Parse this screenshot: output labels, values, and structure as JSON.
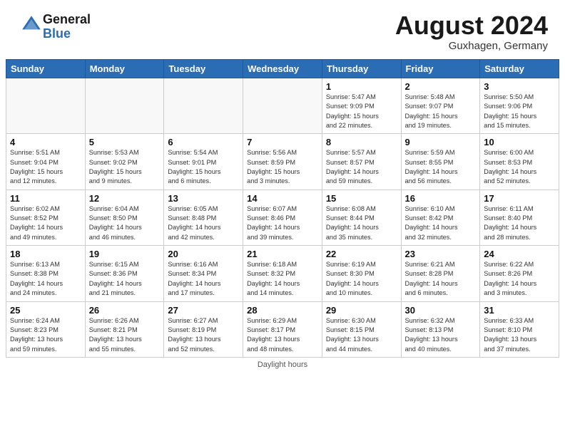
{
  "header": {
    "logo_general": "General",
    "logo_blue": "Blue",
    "month_title": "August 2024",
    "location": "Guxhagen, Germany"
  },
  "days_of_week": [
    "Sunday",
    "Monday",
    "Tuesday",
    "Wednesday",
    "Thursday",
    "Friday",
    "Saturday"
  ],
  "footer": {
    "note": "Daylight hours"
  },
  "weeks": [
    [
      {
        "day": "",
        "info": ""
      },
      {
        "day": "",
        "info": ""
      },
      {
        "day": "",
        "info": ""
      },
      {
        "day": "",
        "info": ""
      },
      {
        "day": "1",
        "info": "Sunrise: 5:47 AM\nSunset: 9:09 PM\nDaylight: 15 hours\nand 22 minutes."
      },
      {
        "day": "2",
        "info": "Sunrise: 5:48 AM\nSunset: 9:07 PM\nDaylight: 15 hours\nand 19 minutes."
      },
      {
        "day": "3",
        "info": "Sunrise: 5:50 AM\nSunset: 9:06 PM\nDaylight: 15 hours\nand 15 minutes."
      }
    ],
    [
      {
        "day": "4",
        "info": "Sunrise: 5:51 AM\nSunset: 9:04 PM\nDaylight: 15 hours\nand 12 minutes."
      },
      {
        "day": "5",
        "info": "Sunrise: 5:53 AM\nSunset: 9:02 PM\nDaylight: 15 hours\nand 9 minutes."
      },
      {
        "day": "6",
        "info": "Sunrise: 5:54 AM\nSunset: 9:01 PM\nDaylight: 15 hours\nand 6 minutes."
      },
      {
        "day": "7",
        "info": "Sunrise: 5:56 AM\nSunset: 8:59 PM\nDaylight: 15 hours\nand 3 minutes."
      },
      {
        "day": "8",
        "info": "Sunrise: 5:57 AM\nSunset: 8:57 PM\nDaylight: 14 hours\nand 59 minutes."
      },
      {
        "day": "9",
        "info": "Sunrise: 5:59 AM\nSunset: 8:55 PM\nDaylight: 14 hours\nand 56 minutes."
      },
      {
        "day": "10",
        "info": "Sunrise: 6:00 AM\nSunset: 8:53 PM\nDaylight: 14 hours\nand 52 minutes."
      }
    ],
    [
      {
        "day": "11",
        "info": "Sunrise: 6:02 AM\nSunset: 8:52 PM\nDaylight: 14 hours\nand 49 minutes."
      },
      {
        "day": "12",
        "info": "Sunrise: 6:04 AM\nSunset: 8:50 PM\nDaylight: 14 hours\nand 46 minutes."
      },
      {
        "day": "13",
        "info": "Sunrise: 6:05 AM\nSunset: 8:48 PM\nDaylight: 14 hours\nand 42 minutes."
      },
      {
        "day": "14",
        "info": "Sunrise: 6:07 AM\nSunset: 8:46 PM\nDaylight: 14 hours\nand 39 minutes."
      },
      {
        "day": "15",
        "info": "Sunrise: 6:08 AM\nSunset: 8:44 PM\nDaylight: 14 hours\nand 35 minutes."
      },
      {
        "day": "16",
        "info": "Sunrise: 6:10 AM\nSunset: 8:42 PM\nDaylight: 14 hours\nand 32 minutes."
      },
      {
        "day": "17",
        "info": "Sunrise: 6:11 AM\nSunset: 8:40 PM\nDaylight: 14 hours\nand 28 minutes."
      }
    ],
    [
      {
        "day": "18",
        "info": "Sunrise: 6:13 AM\nSunset: 8:38 PM\nDaylight: 14 hours\nand 24 minutes."
      },
      {
        "day": "19",
        "info": "Sunrise: 6:15 AM\nSunset: 8:36 PM\nDaylight: 14 hours\nand 21 minutes."
      },
      {
        "day": "20",
        "info": "Sunrise: 6:16 AM\nSunset: 8:34 PM\nDaylight: 14 hours\nand 17 minutes."
      },
      {
        "day": "21",
        "info": "Sunrise: 6:18 AM\nSunset: 8:32 PM\nDaylight: 14 hours\nand 14 minutes."
      },
      {
        "day": "22",
        "info": "Sunrise: 6:19 AM\nSunset: 8:30 PM\nDaylight: 14 hours\nand 10 minutes."
      },
      {
        "day": "23",
        "info": "Sunrise: 6:21 AM\nSunset: 8:28 PM\nDaylight: 14 hours\nand 6 minutes."
      },
      {
        "day": "24",
        "info": "Sunrise: 6:22 AM\nSunset: 8:26 PM\nDaylight: 14 hours\nand 3 minutes."
      }
    ],
    [
      {
        "day": "25",
        "info": "Sunrise: 6:24 AM\nSunset: 8:23 PM\nDaylight: 13 hours\nand 59 minutes."
      },
      {
        "day": "26",
        "info": "Sunrise: 6:26 AM\nSunset: 8:21 PM\nDaylight: 13 hours\nand 55 minutes."
      },
      {
        "day": "27",
        "info": "Sunrise: 6:27 AM\nSunset: 8:19 PM\nDaylight: 13 hours\nand 52 minutes."
      },
      {
        "day": "28",
        "info": "Sunrise: 6:29 AM\nSunset: 8:17 PM\nDaylight: 13 hours\nand 48 minutes."
      },
      {
        "day": "29",
        "info": "Sunrise: 6:30 AM\nSunset: 8:15 PM\nDaylight: 13 hours\nand 44 minutes."
      },
      {
        "day": "30",
        "info": "Sunrise: 6:32 AM\nSunset: 8:13 PM\nDaylight: 13 hours\nand 40 minutes."
      },
      {
        "day": "31",
        "info": "Sunrise: 6:33 AM\nSunset: 8:10 PM\nDaylight: 13 hours\nand 37 minutes."
      }
    ]
  ]
}
